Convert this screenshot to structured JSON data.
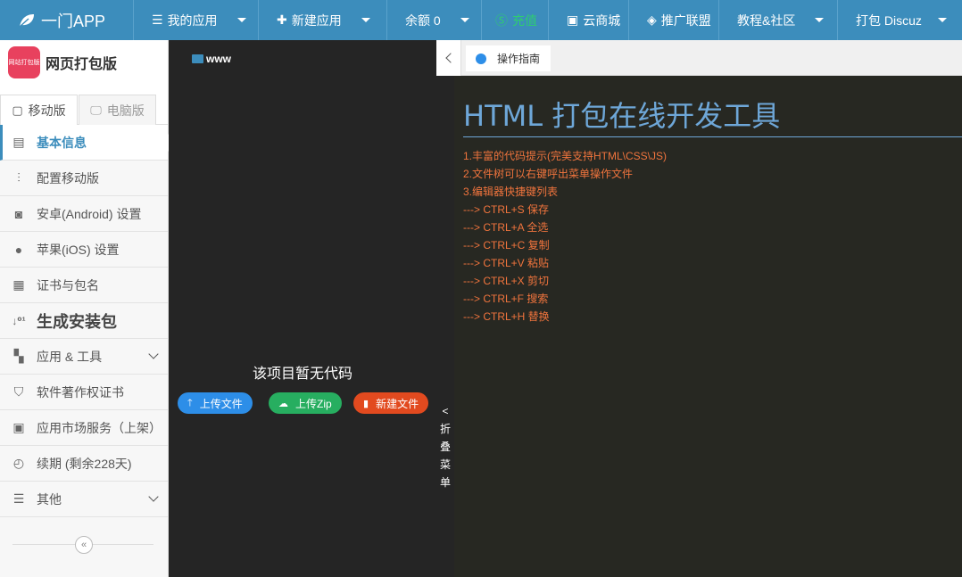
{
  "navbar": {
    "brand": "一门APP",
    "items": [
      {
        "icon": "menu-icon",
        "label": "我的应用",
        "dropdown": true
      },
      {
        "icon": "plus-icon",
        "label": "新建应用",
        "dropdown": true
      },
      {
        "icon": "",
        "label": "余额 0",
        "dropdown": true
      },
      {
        "icon": "yen-icon",
        "label": "充值",
        "dropdown": false
      },
      {
        "icon": "store-icon",
        "label": "云商城",
        "dropdown": false
      },
      {
        "icon": "share-icon",
        "label": "推广联盟",
        "dropdown": false
      },
      {
        "icon": "",
        "label": "教程&社区",
        "dropdown": true
      },
      {
        "icon": "",
        "label": "打包 Discuz",
        "dropdown": true
      }
    ]
  },
  "sidebar": {
    "app_logo_text": "网站打包版",
    "app_name": "网页打包版",
    "tabs": [
      {
        "label": "移动版",
        "icon": "mobile-icon",
        "active": true
      },
      {
        "label": "电脑版",
        "icon": "desktop-icon",
        "active": false
      }
    ],
    "menu": [
      {
        "label": "基本信息",
        "icon": "document-icon",
        "active": true
      },
      {
        "label": "配置移动版",
        "icon": "sliders-icon"
      },
      {
        "label": "安卓(Android) 设置",
        "icon": "android-icon"
      },
      {
        "label": "苹果(iOS) 设置",
        "icon": "apple-icon"
      },
      {
        "label": "证书与包名",
        "icon": "certificate-icon"
      },
      {
        "label": "生成安装包",
        "icon": "binary-sort-icon",
        "big": true
      },
      {
        "label": "应用 & 工具",
        "icon": "apps-icon",
        "expandable": true
      },
      {
        "label": "软件著作权证书",
        "icon": "shield-icon"
      },
      {
        "label": "应用市场服务（上架）",
        "icon": "market-icon"
      },
      {
        "label": "续期 (剩余228天)",
        "icon": "clock-icon"
      },
      {
        "label": "其他",
        "icon": "bars-icon",
        "expandable": true
      }
    ]
  },
  "filetree": {
    "root": "www",
    "empty_text": "该项目暂无代码",
    "buttons": {
      "upload": "上传文件",
      "zip": "上传Zip",
      "new_file": "新建文件"
    }
  },
  "fold": {
    "arrow": "<",
    "chars": [
      "折",
      "叠",
      "菜",
      "单"
    ]
  },
  "editor": {
    "tab_label": "操作指南",
    "title": "HTML 打包在线开发工具",
    "lines": [
      "1.丰富的代码提示(完美支持HTML\\CSS\\JS)",
      "2.文件树可以右键呼出菜单操作文件",
      "3.编辑器快捷键列表",
      "---> CTRL+S 保存",
      "---> CTRL+A 全选",
      "---> CTRL+C 复制",
      "---> CTRL+V 粘贴",
      "---> CTRL+X 剪切",
      "---> CTRL+F 搜索",
      "---> CTRL+H 替换"
    ]
  }
}
